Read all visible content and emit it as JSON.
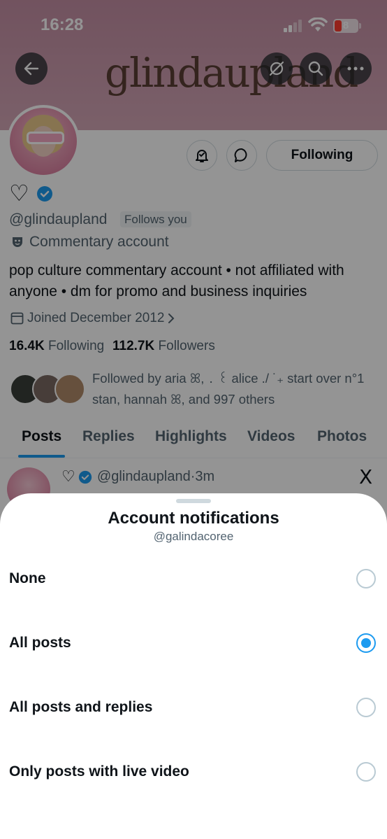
{
  "status_bar": {
    "time": "16:28",
    "battery": "8"
  },
  "banner": {
    "text": "glindaupland"
  },
  "profile": {
    "following_label": "Following",
    "heart": "♡",
    "handle": "@glindaupland",
    "follows_you": "Follows you",
    "category": "Commentary account",
    "bio_line1": "pop culture commentary account • not affiliated with",
    "bio_line2": "anyone • dm for promo and business inquiries",
    "joined": "Joined December 2012",
    "following_count": "16.4K",
    "following_text": "Following",
    "followers_count": "112.7K",
    "followers_text": "Followers",
    "followed_by_line1": "Followed by aria ꕤ, ․ ꒰ alice ./ ˙₊ start over n°1",
    "followed_by_line2": "stan, hannah ꕤ, and 997 others"
  },
  "tabs": [
    "Posts",
    "Replies",
    "Highlights",
    "Videos",
    "Photos"
  ],
  "post_preview": {
    "heart": "♡",
    "handle": "@glindaupland",
    "sep": "·",
    "time": "3m",
    "x_logo": "X"
  },
  "sheet": {
    "title": "Account notifications",
    "subtitle": "@galindacoree",
    "options": [
      {
        "label": "None",
        "selected": false
      },
      {
        "label": "All posts",
        "selected": true
      },
      {
        "label": "All posts and replies",
        "selected": false
      },
      {
        "label": "Only posts with live video",
        "selected": false
      }
    ]
  },
  "colors": {
    "accent": "#1d9bf0",
    "banner": "#c48fa4",
    "verified": "#1d9bf0"
  }
}
